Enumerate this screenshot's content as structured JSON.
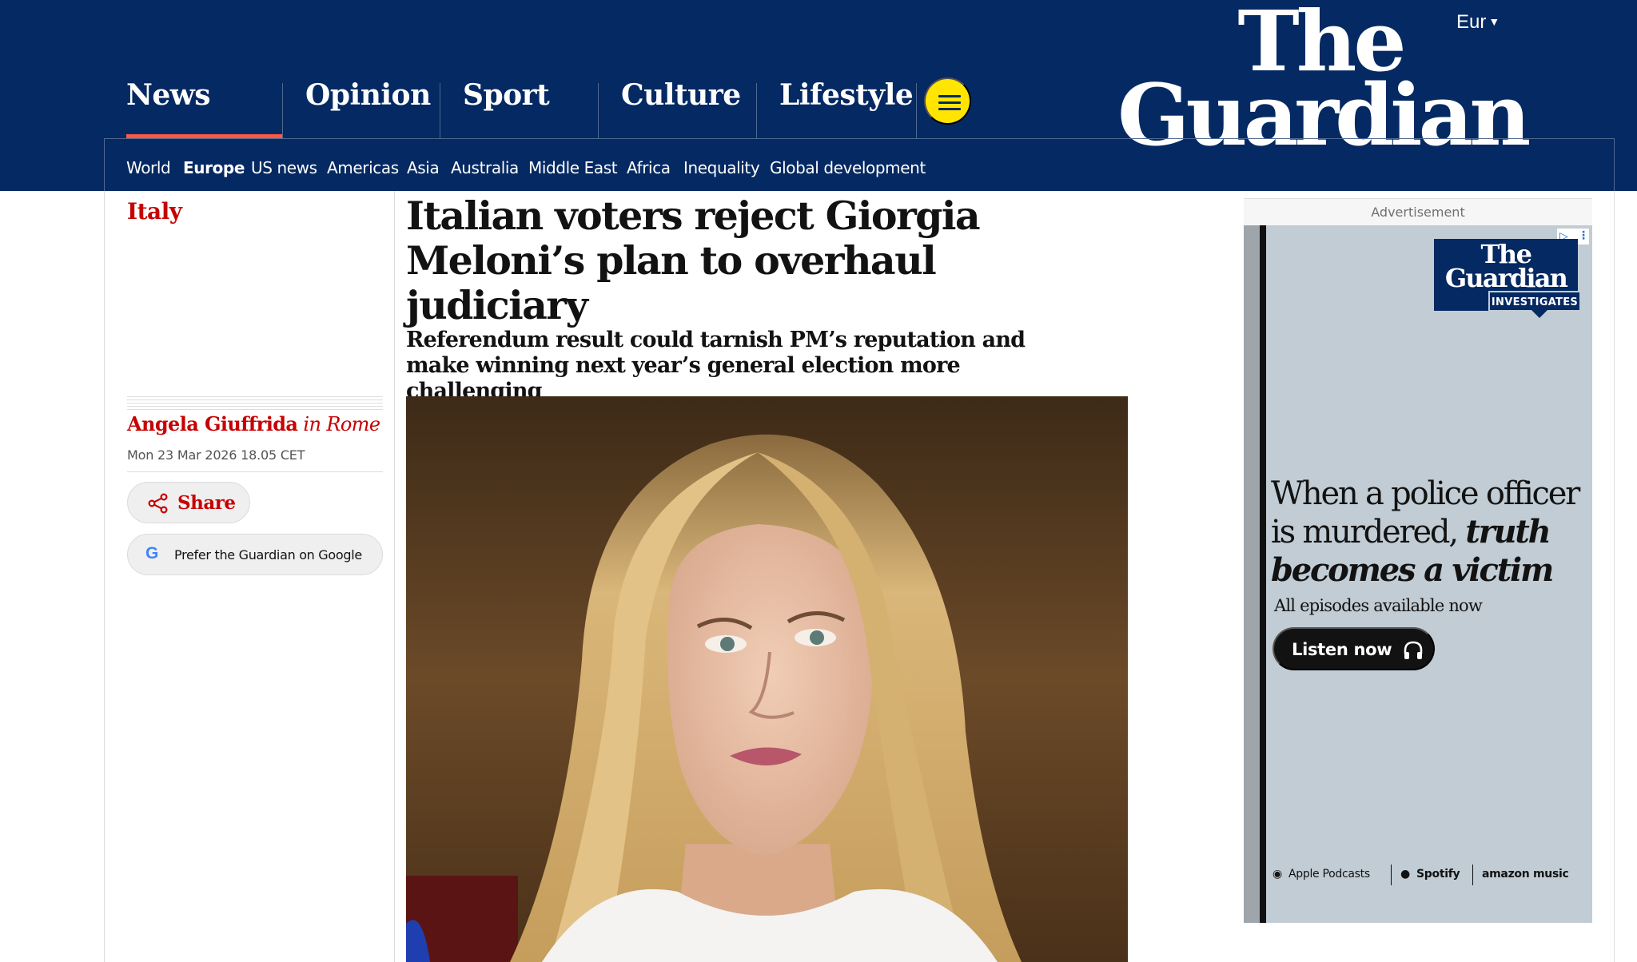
{
  "header": {
    "edition": "Eur",
    "logo": {
      "line1": "The",
      "line2": "Guardian"
    },
    "pillars": [
      "News",
      "Opinion",
      "Sport",
      "Culture",
      "Lifestyle"
    ],
    "active_pillar": "News",
    "subnav": [
      "World",
      "Europe",
      "US news",
      "Americas",
      "Asia",
      "Australia",
      "Middle East",
      "Africa",
      "Inequality",
      "Global development"
    ],
    "active_subnav": "Europe"
  },
  "article": {
    "section": "Italy",
    "headline": "Italian voters reject Giorgia Meloni’s plan to overhaul judiciary",
    "standfirst": "Referendum result could tarnish PM’s reputation and make winning next year’s general election more challenging",
    "byline_name": "Angela Giuffrida",
    "byline_location": "in Rome",
    "dateline": "Mon 23 Mar 2026 18.05 CET",
    "share_label": "Share",
    "google_label": "Prefer the Guardian on Google",
    "google_glyph": "G"
  },
  "ad": {
    "label": "Advertisement",
    "logo_line1": "The",
    "logo_line2": "Guardian",
    "logo_tag": "INVESTIGATES",
    "headline_plain": "When a police officer is murdered,",
    "headline_italic": "truth becomes a victim",
    "subtitle": "All episodes available now",
    "cta": "Listen now",
    "platforms": [
      "Apple Podcasts",
      "Spotify",
      "amazon music"
    ]
  },
  "colors": {
    "brand_blue": "#052962",
    "news_red": "#c70000",
    "pillar_underline": "#ff5943",
    "menu_yellow": "#ffe500"
  }
}
